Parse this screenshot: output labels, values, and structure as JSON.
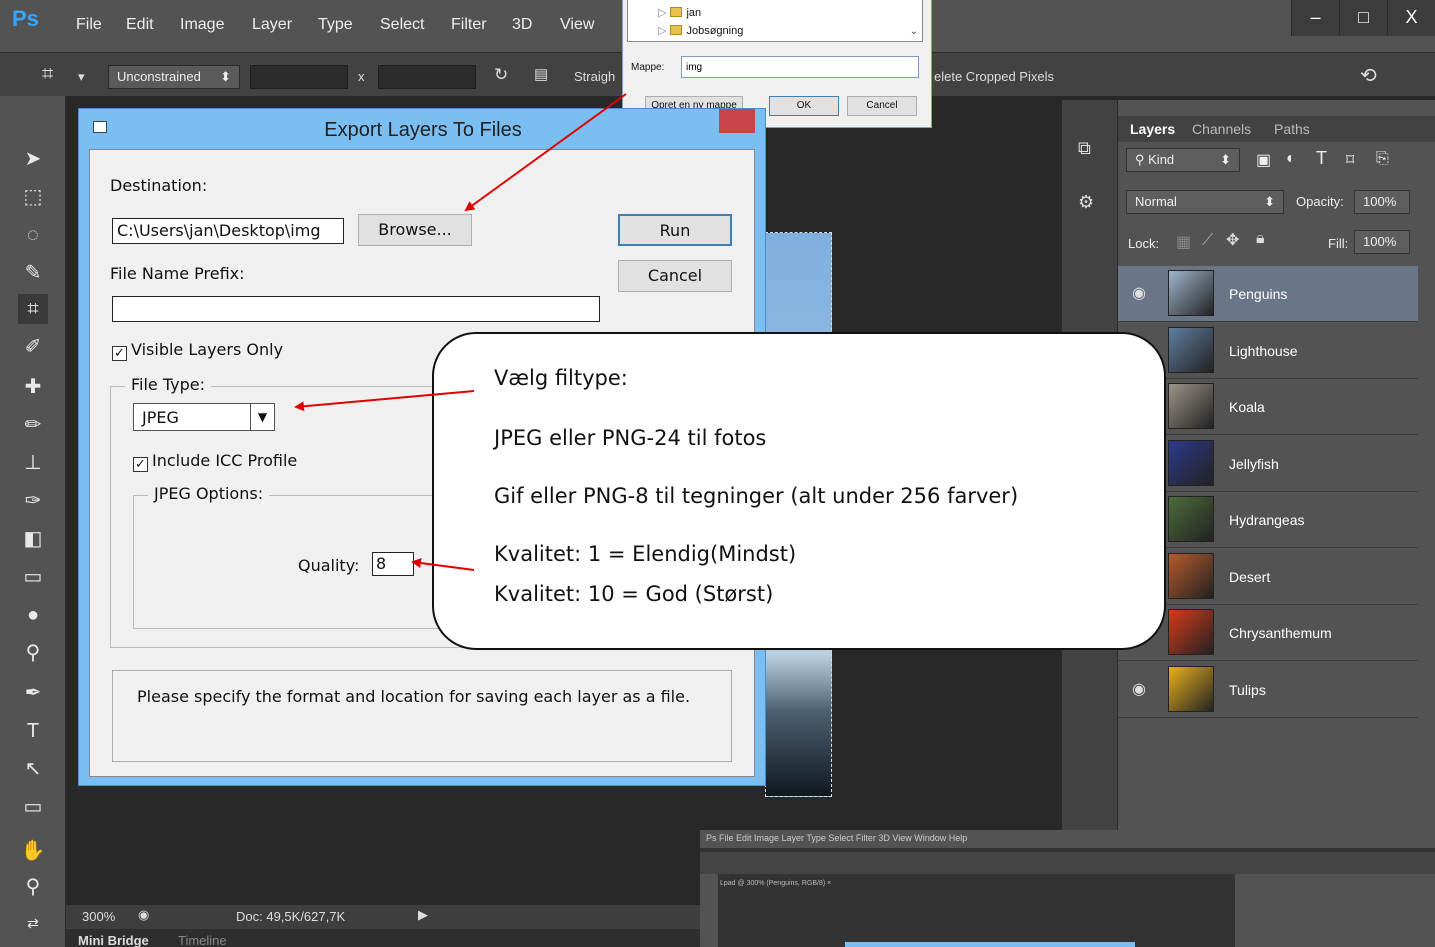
{
  "app": {
    "logo": "Ps",
    "menu": [
      "File",
      "Edit",
      "Image",
      "Layer",
      "Type",
      "Select",
      "Filter",
      "3D",
      "View"
    ],
    "window_controls": [
      "–",
      "□",
      "X"
    ]
  },
  "options_bar": {
    "ratio": "Unconstrained",
    "separator": "x",
    "straighten_label": "Straigh",
    "delete_cropped": "elete Cropped Pixels"
  },
  "status_bar": {
    "zoom": "300%",
    "doc": "Doc: 49,5K/627,7K"
  },
  "bottom_tabs": [
    "Mini Bridge",
    "Timeline"
  ],
  "layers_panel": {
    "tabs": [
      "Layers",
      "Channels",
      "Paths"
    ],
    "filter_kind": "Kind",
    "blend_mode": "Normal",
    "opacity_label": "Opacity:",
    "opacity_value": "100%",
    "lock_label": "Lock:",
    "fill_label": "Fill:",
    "fill_value": "100%",
    "layers": [
      {
        "name": "Penguins",
        "color": "#9fb6cc",
        "visible": true,
        "selected": true
      },
      {
        "name": "Lighthouse",
        "color": "#5f7ea0",
        "visible": false,
        "selected": false
      },
      {
        "name": "Koala",
        "color": "#9a9488",
        "visible": false,
        "selected": false
      },
      {
        "name": "Jellyfish",
        "color": "#2e3a8a",
        "visible": false,
        "selected": false
      },
      {
        "name": "Hydrangeas",
        "color": "#4d6b3a",
        "visible": false,
        "selected": false
      },
      {
        "name": "Desert",
        "color": "#b65a2c",
        "visible": false,
        "selected": false
      },
      {
        "name": "Chrysanthemum",
        "color": "#d63a1a",
        "visible": false,
        "selected": false
      },
      {
        "name": "Tulips",
        "color": "#e8b11c",
        "visible": true,
        "selected": false
      }
    ]
  },
  "export_dialog": {
    "title": "Export Layers To Files",
    "destination_label": "Destination:",
    "destination_value": "C:\\Users\\jan\\Desktop\\img",
    "browse_label": "Browse...",
    "run_label": "Run",
    "cancel_label": "Cancel",
    "prefix_label": "File Name Prefix:",
    "prefix_value": "",
    "visible_only_label": "Visible Layers Only",
    "file_type_label": "File Type:",
    "file_type_value": "JPEG",
    "icc_label": "Include ICC Profile",
    "jpeg_options_label": "JPEG Options:",
    "quality_label": "Quality:",
    "quality_value": "8",
    "help_text": "Please specify the format and location for saving each layer as a file."
  },
  "folder_dialog": {
    "tree": [
      "jan",
      "Jobsøgning"
    ],
    "folder_label": "Mappe:",
    "folder_value": "img",
    "new_folder_label": "Opret en ny mappe",
    "ok_label": "OK",
    "cancel_label": "Cancel"
  },
  "callout": {
    "heading": "Vælg filtype:",
    "line1": "JPEG eller PNG-24 til fotos",
    "line2": "Gif eller PNG-8 til tegninger (alt under 256 farver)",
    "line3": "Kvalitet: 1 = Elendig(Mindst)",
    "line4": "Kvalitet: 10 = God (Størst)"
  },
  "mini_screenshot": {
    "menu": "Ps   File   Edit   Image   Layer   Type   Select   Filter   3D   View   Window   Help",
    "doc_tab": "Lpad @ 300% (Penguins, RGB/8) ×"
  },
  "colors": {
    "arrow": "#e00000",
    "ps_blue": "#31a8ff",
    "dialog_frame": "#7bbef2"
  }
}
